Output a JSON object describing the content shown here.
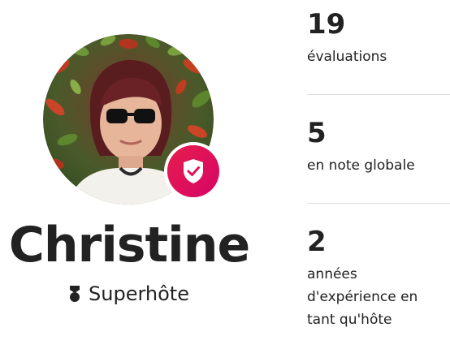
{
  "host": {
    "name": "Christine",
    "role": "Superhôte"
  },
  "icons": {
    "verified_badge": "shield-check-icon",
    "superhost": "superhost-medal-icon"
  },
  "colors": {
    "badge_start": "#e61e4d",
    "badge_end": "#d70466",
    "text": "#222222",
    "divider": "#dddddd"
  },
  "stats": [
    {
      "value": "19",
      "label": "évaluations"
    },
    {
      "value": "5",
      "label": "en note globale"
    },
    {
      "value": "2",
      "label": "années d'expérience en tant qu'hôte"
    }
  ]
}
